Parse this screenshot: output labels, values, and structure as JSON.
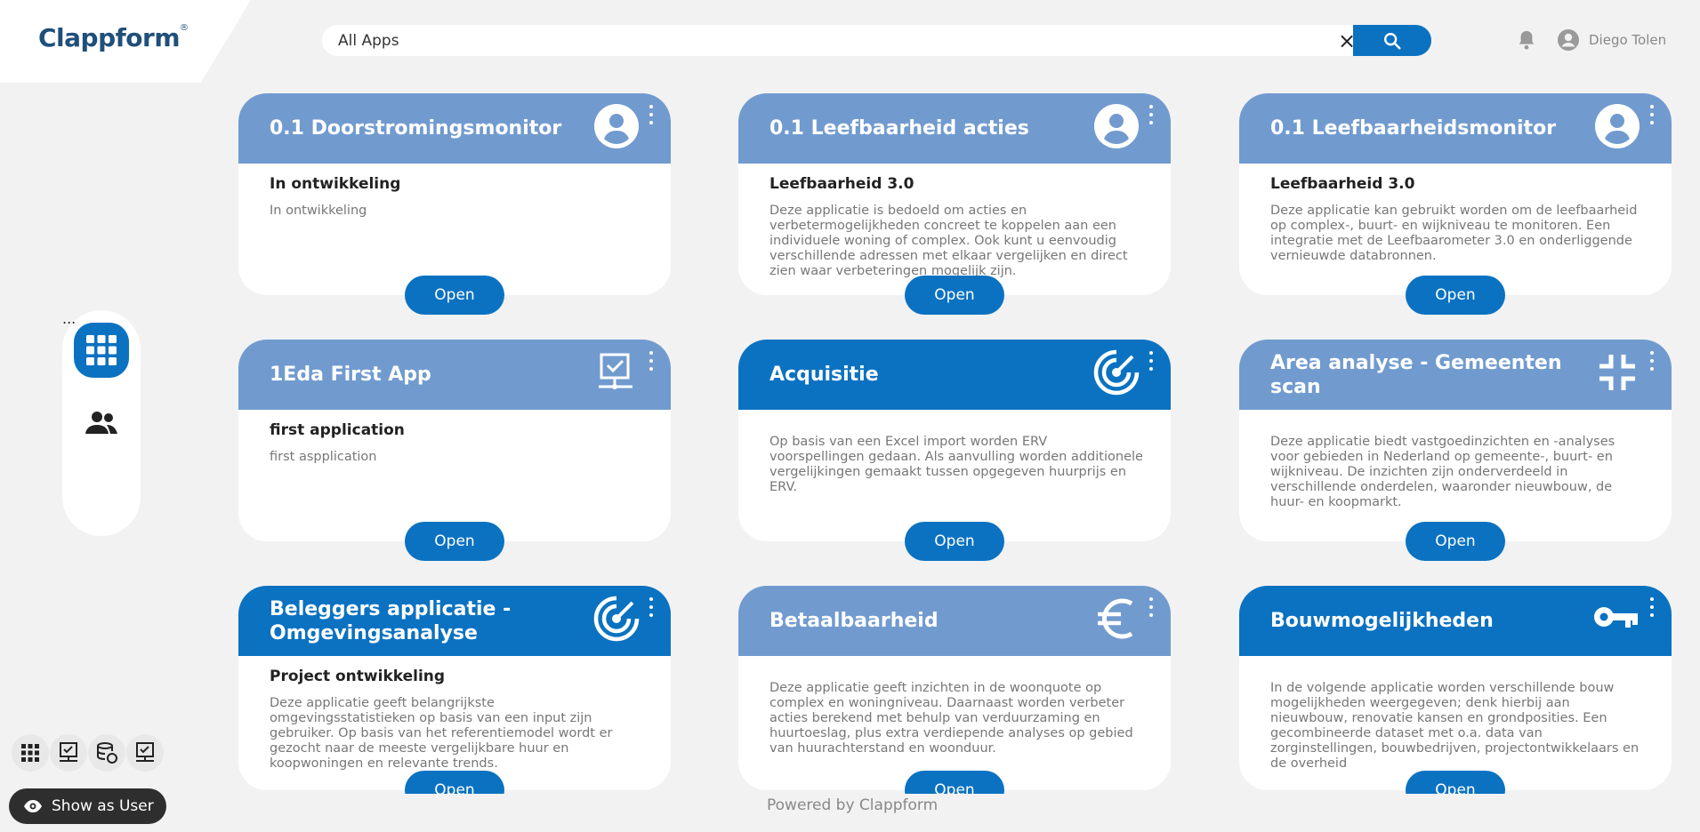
{
  "logo": {
    "text": "Clappform",
    "mark": "®"
  },
  "search": {
    "value": "All Apps",
    "clear_icon": "×"
  },
  "user": {
    "name": "Diego Tolen"
  },
  "sidebar": {
    "items": [
      "apps-grid-icon",
      "users-icon",
      "add-list-icon"
    ]
  },
  "tools": [
    "grid-icon",
    "monitor-check-icon",
    "database-sync-icon",
    "monitor-check-icon"
  ],
  "show_as_user": "Show as User",
  "footer": {
    "powered": "Powered by Clappform"
  },
  "cards": [
    {
      "title": "0.1 Doorstromingsmonitor",
      "subtitle": "In ontwikkeling",
      "desc": "In ontwikkeling",
      "style": "light",
      "icon": "user-icon",
      "open": "Open"
    },
    {
      "title": "0.1 Leefbaarheid acties",
      "subtitle": "Leefbaarheid 3.0",
      "desc": "Deze applicatie is bedoeld om acties en verbetermogelijkheden concreet te koppelen aan een individuele woning of complex. Ook kunt u eenvoudig verschillende adressen met elkaar vergelijken en direct zien waar verbeteringen mogelijk zijn.",
      "style": "light",
      "icon": "user-icon",
      "open": "Open"
    },
    {
      "title": "0.1 Leefbaarheidsmonitor",
      "subtitle": "Leefbaarheid 3.0",
      "desc": "Deze applicatie kan gebruikt worden om de leefbaarheid op complex-, buurt- en wijkniveau te monitoren. Een integratie met de Leefbaarometer 3.0 en onderliggende vernieuwde databronnen.",
      "style": "light",
      "icon": "user-icon",
      "open": "Open"
    },
    {
      "title": "1Eda First App",
      "subtitle": "first application",
      "desc": "first aspplication",
      "style": "light",
      "icon": "monitor-check-icon",
      "open": "Open"
    },
    {
      "title": "Acquisitie",
      "subtitle": "",
      "desc": "Op basis van een Excel import worden ERV voorspellingen gedaan. Als aanvulling worden additionele vergelijkingen gemaakt tussen opgegeven huurprijs en ERV.",
      "style": "dark",
      "icon": "target-icon",
      "open": "Open"
    },
    {
      "title": "Area analyse - Gemeenten scan",
      "subtitle": "",
      "desc": "Deze applicatie biedt vastgoedinzichten en -analyses voor gebieden in Nederland op gemeente-, buurt- en wijkniveau. De inzichten zijn onderverdeeld in verschillende onderdelen, waaronder nieuwbouw, de huur- en koopmarkt.",
      "style": "light",
      "icon": "collapse-icon",
      "open": "Open"
    },
    {
      "title": "Beleggers applicatie - Omgevingsanalyse",
      "subtitle": "Project ontwikkeling",
      "desc": "Deze applicatie geeft belangrijkste omgevingsstatistieken op basis van een input zijn gebruiker. Op basis van het referentiemodel wordt er gezocht naar de meeste vergelijkbare huur en koopwoningen en relevante trends.",
      "style": "dark",
      "icon": "target-icon",
      "open": "Open"
    },
    {
      "title": "Betaalbaarheid",
      "subtitle": "",
      "desc": "Deze applicatie geeft inzichten in de woonquote op complex en woningniveau. Daarnaast worden verbeter acties berekend met behulp van verduurzaming en huurtoeslag, plus extra verdiepende analyses op gebied van huurachterstand en woonduur.",
      "style": "light",
      "icon": "euro-icon",
      "open": "Open"
    },
    {
      "title": "Bouwmogelijkheden",
      "subtitle": "",
      "desc": "In de volgende applicatie worden verschillende bouw mogelijkheden weergegeven; denk hierbij aan nieuwbouw, renovatie kansen en grondposities. Een gecombineerde dataset met o.a. data van zorginstellingen, bouwbedrijven, projectontwikkelaars en de overheid",
      "style": "dark",
      "icon": "key-icon",
      "open": "Open"
    }
  ]
}
